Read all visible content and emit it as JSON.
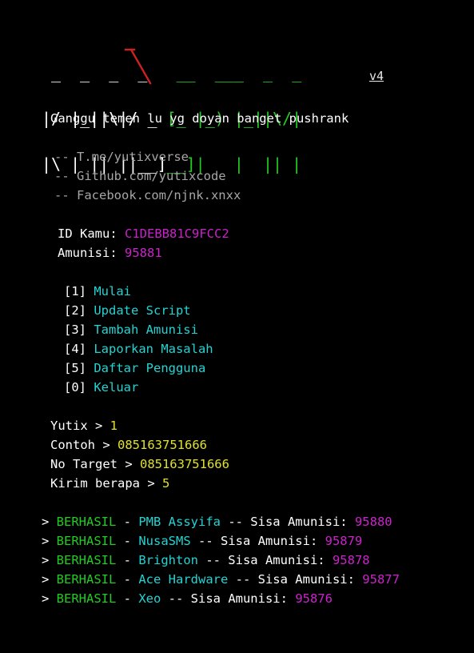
{
  "app": {
    "title": "KANGSPAM",
    "version_label": "v4",
    "tagline": "Ganggu temen lu yg doyan banget pushrank",
    "banner_rows": [
      {
        "white": " _  _  _  _  ",
        "green": " __  ___  _  _ ",
        "red_tick": true
      },
      {
        "white": "|/ |_||\\|/ _ ",
        "green": "[_ |_) |_||\\/|",
        "red_tick": false
      },
      {
        "white": "|\\ | || ||__]",
        "green": "__]|   |  || |",
        "red_tick": false
      }
    ],
    "colors": {
      "background": "#000000",
      "white": "#ffffff",
      "gray": "#a6a6a6",
      "cyan": "#22d4d4",
      "green": "#22cc22",
      "magenta": "#cc22cc",
      "yellow": "#e0e030",
      "red": "#cc2222"
    }
  },
  "links": [
    {
      "dash": "-- ",
      "url": "T.me/yutixverse"
    },
    {
      "dash": "-- ",
      "url": "Github.com/yutixcode"
    },
    {
      "dash": "-- ",
      "url": "Facebook.com/njnk.xnxx"
    }
  ],
  "info": {
    "id_label": "ID Kamu: ",
    "id_value": "C1DEBB81C9FCC2",
    "ammo_label": "Amunisi: ",
    "ammo_value": "95881"
  },
  "menu": {
    "items": [
      {
        "key": "[1] ",
        "label": "Mulai"
      },
      {
        "key": "[2] ",
        "label": "Update Script"
      },
      {
        "key": "[3] ",
        "label": "Tambah Amunisi"
      },
      {
        "key": "[4] ",
        "label": "Laporkan Masalah"
      },
      {
        "key": "[5] ",
        "label": "Daftar Pengguna"
      },
      {
        "key": "[0] ",
        "label": "Keluar"
      }
    ]
  },
  "prompts": [
    {
      "label": "Yutix > ",
      "value": "1"
    },
    {
      "label": "Contoh > ",
      "value": "085163751666"
    },
    {
      "label": "No Target > ",
      "value": "085163751666"
    },
    {
      "label": "Kirim berapa > ",
      "value": "5"
    }
  ],
  "results": {
    "bullet": "> ",
    "status": "BERHASIL",
    "sep": " - ",
    "suffix": " -- Sisa Amunisi: ",
    "rows": [
      {
        "service": "PMB Assyifa",
        "remaining": "95880"
      },
      {
        "service": "NusaSMS",
        "remaining": "95879"
      },
      {
        "service": "Brighton",
        "remaining": "95878"
      },
      {
        "service": "Ace Hardware",
        "remaining": "95877"
      },
      {
        "service": "Xeo",
        "remaining": "95876"
      }
    ]
  }
}
